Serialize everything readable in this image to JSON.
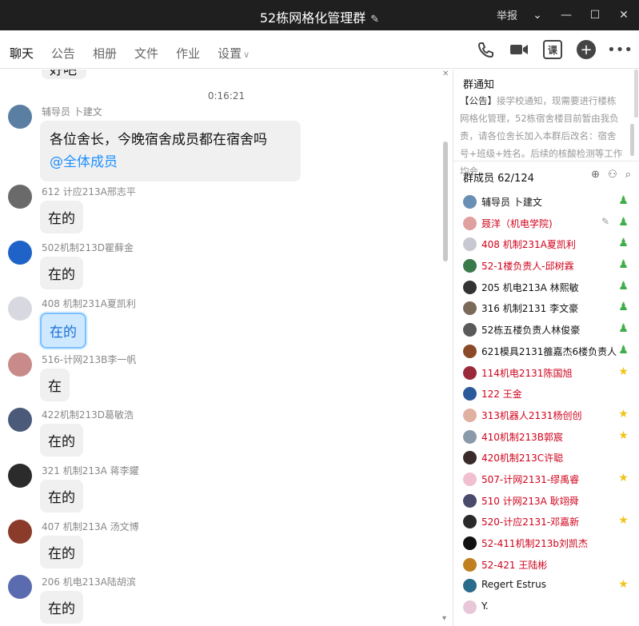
{
  "window": {
    "title": "52栋网格化管理群",
    "report_label": "举报",
    "colors": {
      "titlebar_bg": "#1f1f1f",
      "mention": "#1e90ff",
      "member_red": "#d0021b",
      "admin_green": "#3fae49",
      "star": "#f0c419"
    }
  },
  "tabs": [
    {
      "label": "聊天"
    },
    {
      "label": "公告"
    },
    {
      "label": "相册"
    },
    {
      "label": "文件"
    },
    {
      "label": "作业"
    },
    {
      "label": "设置"
    }
  ],
  "toolbar": {
    "course_label": "课",
    "icons": [
      "phone-icon",
      "video-icon",
      "course-icon",
      "add-icon",
      "more-icon"
    ]
  },
  "chat": {
    "stub_text": "好吧",
    "timestamp": "0:16:21",
    "messages": [
      {
        "name": "辅导员 卜建文",
        "text": "各位舍长，今晚宿舍成员都在宿舍吗",
        "mention": "@全体成员",
        "avatar_color": "#5b7fa3"
      },
      {
        "name": "612 计应213A邢志平",
        "text": "在的",
        "avatar_color": "#6a6a6a"
      },
      {
        "name": "502机制213D瞿藓金",
        "text": "在的",
        "avatar_color": "#1f63c8"
      },
      {
        "name": "408 机制231A夏凯利",
        "text": "在的",
        "avatar_color": "#d8d8e0"
      },
      {
        "name": "516-计网213B李一帆",
        "text": "在",
        "avatar_color": "#c98a8a"
      },
      {
        "name": "422机制213D葛敏浩",
        "text": "在的",
        "avatar_color": "#4a5a78"
      },
      {
        "name": "321 机制213A 蒋李鑺",
        "text": "在的",
        "avatar_color": "#2b2b2b"
      },
      {
        "name": "407  机制213A  汤文博",
        "text": "在的",
        "avatar_color": "#8a3b2a"
      },
      {
        "name": "206  机电213A陆胡滨",
        "text": "在的",
        "avatar_color": "#5a6bb0"
      }
    ]
  },
  "notice": {
    "title": "群通知",
    "prefix": "【公告】",
    "text": "接学校通知，现需要进行楼栋网格化管理，52栋宿舍楼目前暂由我负责，请各位舍长加入本群后改名：宿舍号+班级+姓名。后续的核酸检测等工作均会..."
  },
  "members": {
    "title": "群成员 62/124",
    "list": [
      {
        "name": "辅导员 卜建文",
        "red": false,
        "badge": "admin",
        "avatar_color": "#6a8fb5"
      },
      {
        "name": "聂洋（机电学院)",
        "red": true,
        "badge": "admin",
        "edit": true,
        "avatar_color": "#e0a0a0"
      },
      {
        "name": "408 机制231A夏凯利",
        "red": true,
        "badge": "admin",
        "avatar_color": "#c8c8d2"
      },
      {
        "name": "52-1楼负责人-邱树霖",
        "red": true,
        "badge": "admin",
        "avatar_color": "#3a7a4a"
      },
      {
        "name": "205  机电213A  林熙敏",
        "red": false,
        "badge": "admin",
        "avatar_color": "#333333"
      },
      {
        "name": "316    机制2131   李文豪",
        "red": false,
        "badge": "admin",
        "avatar_color": "#7a6a5a"
      },
      {
        "name": "52栋五楼负责人林俊豪",
        "red": false,
        "badge": "admin",
        "avatar_color": "#5a5a5a"
      },
      {
        "name": "621模具2131雒嘉杰6楼负责人",
        "red": false,
        "badge": "admin-star",
        "avatar_color": "#8a4a2a"
      },
      {
        "name": "114机电2131陈国旭",
        "red": true,
        "badge": "star",
        "avatar_color": "#9a2a3a"
      },
      {
        "name": "122 王金",
        "red": true,
        "badge": "",
        "avatar_color": "#2a5a9a"
      },
      {
        "name": "313机器人2131杨创创",
        "red": true,
        "badge": "star",
        "avatar_color": "#e0b0a0"
      },
      {
        "name": "410机制213B郭宸",
        "red": true,
        "badge": "star",
        "avatar_color": "#8a9aaa"
      },
      {
        "name": "420机制213C许聪",
        "red": true,
        "badge": "",
        "avatar_color": "#3a2a2a"
      },
      {
        "name": "507-计网2131-缪禹睿",
        "red": true,
        "badge": "star",
        "avatar_color": "#f0c0d0"
      },
      {
        "name": "510 计网213A 耿翊舜",
        "red": true,
        "badge": "",
        "avatar_color": "#4a4a6a"
      },
      {
        "name": "520-计应2131-邓嘉新",
        "red": true,
        "badge": "star",
        "avatar_color": "#2a2a2a"
      },
      {
        "name": "52-411机制213b刘凯杰",
        "red": true,
        "badge": "",
        "avatar_color": "#111111"
      },
      {
        "name": "52-421  王陆彬",
        "red": true,
        "badge": "",
        "avatar_color": "#c08020"
      },
      {
        "name": "Regert Estrus",
        "red": false,
        "badge": "star",
        "avatar_color": "#2a6a8a"
      },
      {
        "name": "Y.",
        "red": false,
        "badge": "",
        "avatar_color": "#e8c8d8"
      }
    ]
  }
}
